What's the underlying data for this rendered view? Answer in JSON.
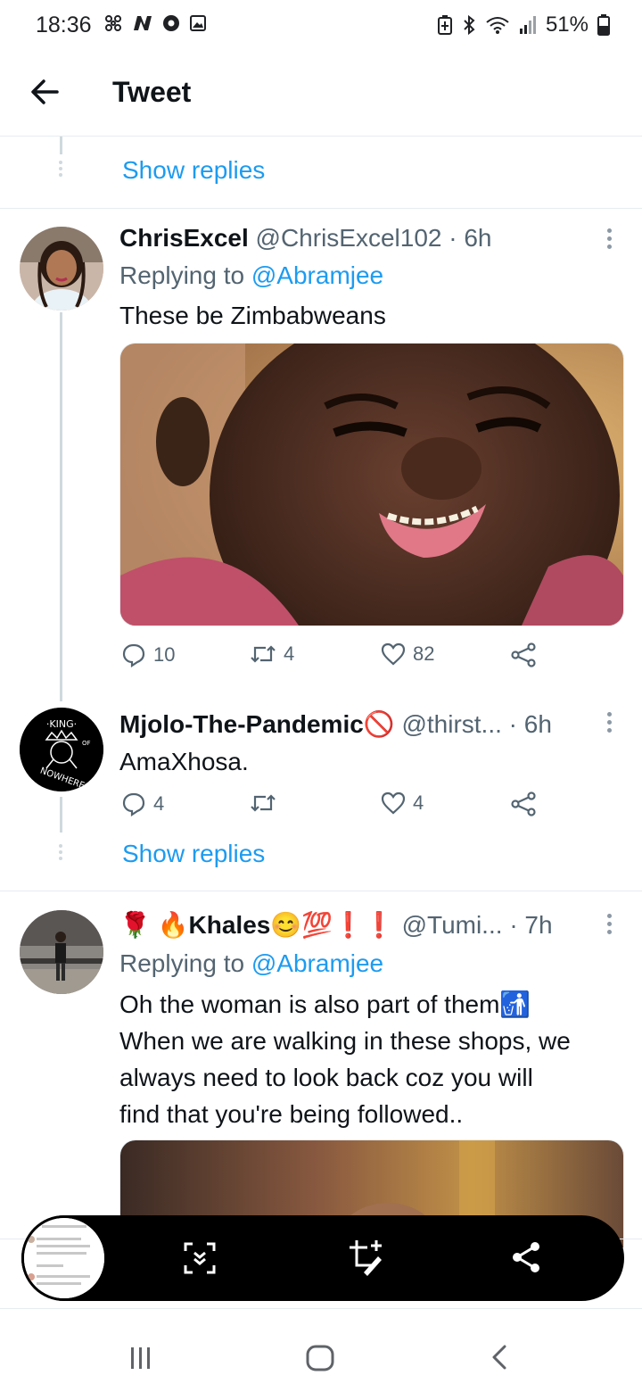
{
  "status_bar": {
    "time": "18:36",
    "battery": "51%",
    "left_icons": [
      "fan-icon",
      "n-icon",
      "app-icon",
      "gallery-icon"
    ],
    "right_icons": [
      "battery-saver-icon",
      "bluetooth-icon",
      "wifi-icon",
      "signal-icon",
      "battery-icon"
    ]
  },
  "header": {
    "title": "Tweet",
    "back_icon": "back-arrow-icon"
  },
  "show_replies_1": "Show replies",
  "tweet1": {
    "name": "ChrisExcel",
    "handle": "@ChrisExcel102 · 6h",
    "replying_label": "Replying to",
    "replying_to": "@Abramjee",
    "text": "These be Zimbabweans",
    "replies": "10",
    "retweets": "4",
    "likes": "82"
  },
  "tweet2": {
    "name": "Mjolo-The-Pandemic",
    "name_emoji": "🚫",
    "handle": "@thirst...",
    "time": "· 6h",
    "text": "AmaXhosa.",
    "replies": "4",
    "retweets": "",
    "likes": "4",
    "avatar": {
      "top_text": "·KING·",
      "bottom_text": "NOWHERE",
      "side_text": "OF"
    }
  },
  "show_replies_2": "Show replies",
  "tweet3": {
    "name_prefix": "🌹 🔥",
    "name": "Khales",
    "name_suffix": "😊💯❗❗",
    "handle": "@Tumi...",
    "time": "· 7h",
    "replying_label": "Replying to",
    "replying_to": "@Abramjee",
    "text_lines": [
      "Oh the woman is also part of them🚮",
      "When we are walking in these shops, we",
      "always need to look back coz you will",
      "find that you're being followed.."
    ]
  },
  "capture_toolbar": {
    "icons": [
      "scroll-capture-icon",
      "edit-crop-icon",
      "share-icon"
    ]
  },
  "nav_bar": {
    "icons": [
      "recents-icon",
      "home-icon",
      "back-icon"
    ]
  },
  "colors": {
    "link": "#1d9bf0",
    "text": "#0f1419",
    "secondary": "#536471",
    "divider": "#e6ecf0"
  }
}
